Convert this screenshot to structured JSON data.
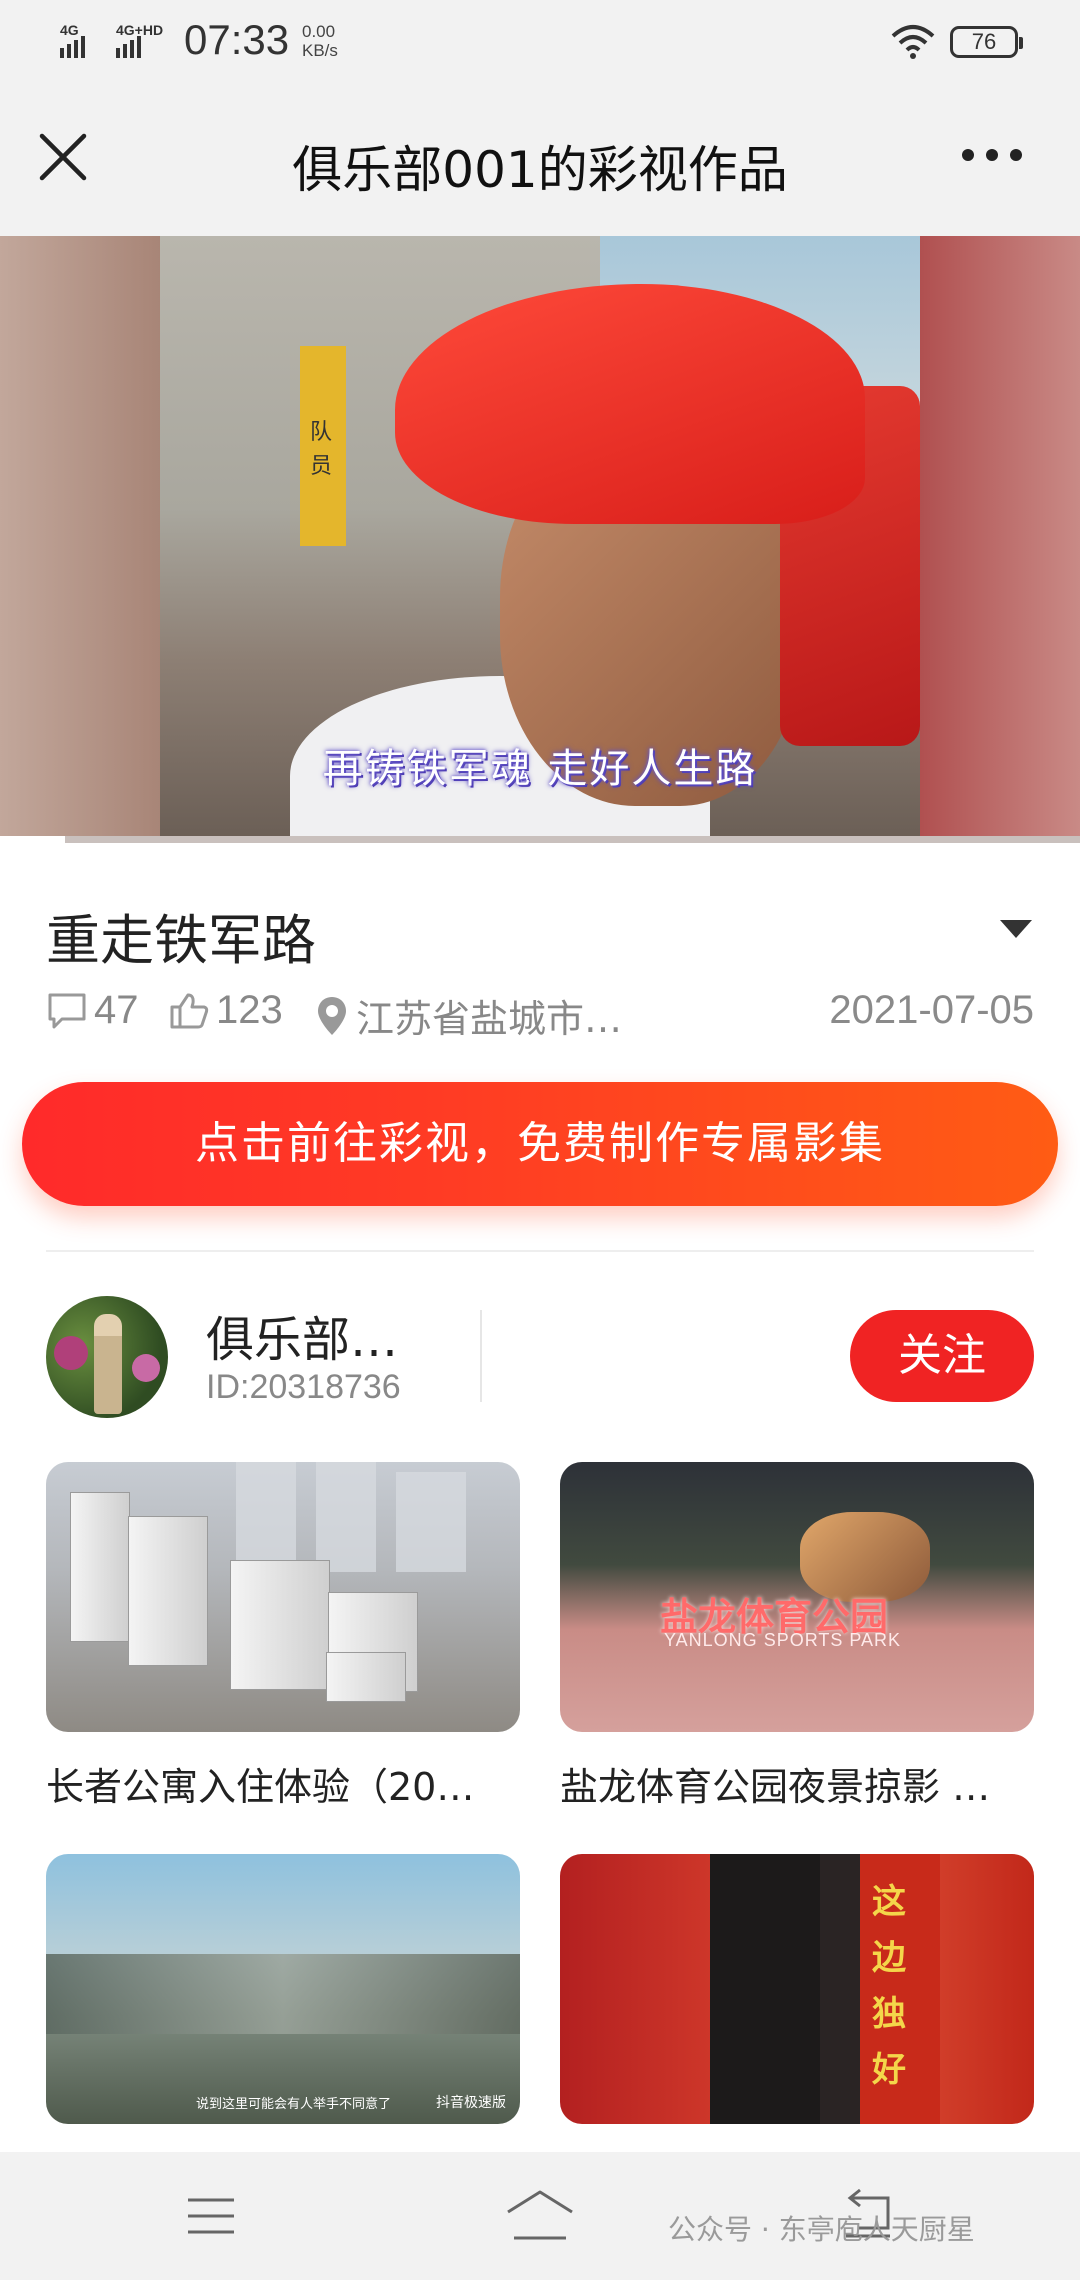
{
  "status_bar": {
    "network1": "4G",
    "network2": "4G+HD",
    "time": "07:33",
    "speed_value": "0.00",
    "speed_unit": "KB/s",
    "battery": "76"
  },
  "nav": {
    "title": "俱乐部001的彩视作品",
    "close_icon": "close-icon",
    "more_icon": "more-icon"
  },
  "video": {
    "plaque_text": "队员",
    "caption": "再铸铁军魂 走好人生路",
    "progress_fraction": 0.06
  },
  "post": {
    "title": "重走铁军路",
    "comments": "47",
    "likes": "123",
    "location": "江苏省盐城市…",
    "date": "2021-07-05"
  },
  "cta": {
    "label": "点击前往彩视，免费制作专属影集"
  },
  "author": {
    "name": "俱乐部…",
    "id": "ID:20318736",
    "follow_label": "关注"
  },
  "grid": {
    "items": [
      {
        "title": "长者公寓入住体验（20…"
      },
      {
        "title": "盐龙体育公园夜景掠影 …",
        "thumb_text": "盐龙体育公园",
        "thumb_sub": "YANLONG SPORTS PARK"
      },
      {
        "title": "",
        "thumb_watermark": "抖音极速版",
        "thumb_caption": "说到这里可能会有人举手不同意了"
      },
      {
        "title": "",
        "thumb_text": "这边独好"
      }
    ]
  },
  "bottom_bar": {
    "watermark": "公众号 · 东亭庖人天厨星"
  },
  "colors": {
    "accent_red": "#f02323",
    "cta_start": "#ff2a2a",
    "cta_end": "#ff5c14"
  }
}
